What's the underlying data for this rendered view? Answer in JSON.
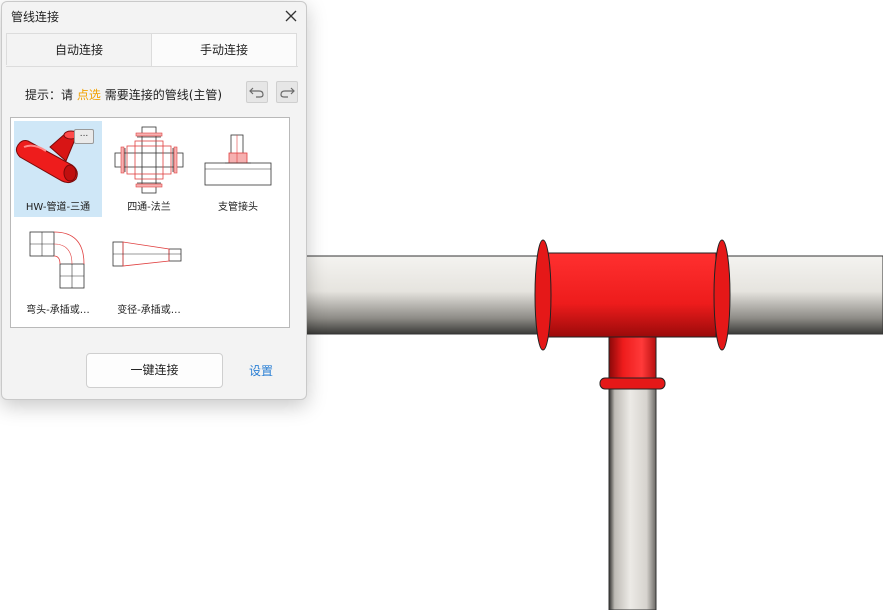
{
  "dialog": {
    "title": "管线连接",
    "tabs": [
      {
        "label": "自动连接",
        "active": false
      },
      {
        "label": "手动连接",
        "active": true
      }
    ],
    "hint": {
      "prefix": "提示：请",
      "action": "点选",
      "suffix": "需要连接的管线(主管)"
    },
    "items": [
      {
        "label": "HW-管道-三通",
        "icon": "tee-fitting-icon",
        "selected": true,
        "more_label": "..."
      },
      {
        "label": "四通-法兰",
        "icon": "cross-flange-icon",
        "selected": false
      },
      {
        "label": "支管接头",
        "icon": "branch-joint-icon",
        "selected": false
      },
      {
        "label": "弯头-承插或…",
        "icon": "elbow-icon",
        "selected": false
      },
      {
        "label": "变径-承插或…",
        "icon": "reducer-icon",
        "selected": false
      }
    ],
    "connect_label": "一键连接",
    "settings_label": "设置"
  },
  "colors": {
    "accent_orange": "#f2a100",
    "link_blue": "#2a7fd4",
    "selection_blue": "#cfe7f7",
    "fitting_red": "#ee1c1c",
    "pipe_gray": "#e9e7e3"
  }
}
